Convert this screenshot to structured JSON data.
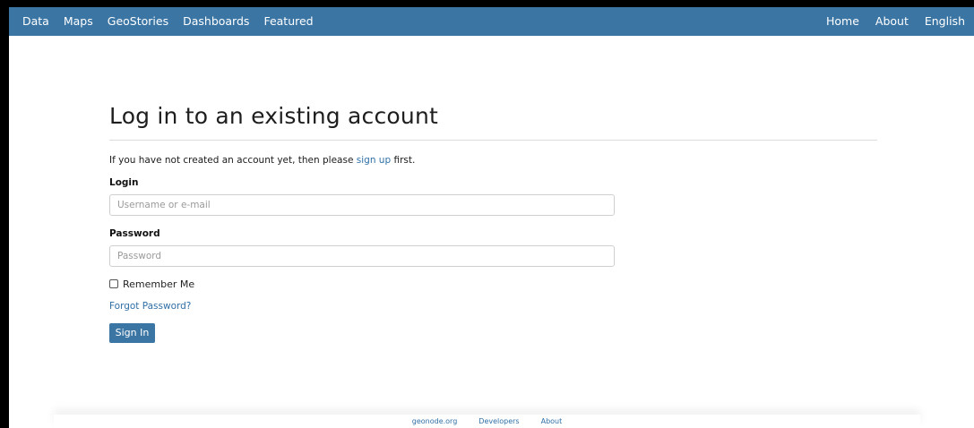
{
  "navbar": {
    "left_items": [
      "Data",
      "Maps",
      "GeoStories",
      "Dashboards",
      "Featured"
    ],
    "right_items": [
      "Home",
      "About",
      "English"
    ],
    "background_color": "#3b75a4"
  },
  "login_page": {
    "title": "Log in to an existing account",
    "intro_before": "If you have not created an account yet, then please ",
    "intro_link": "sign up",
    "intro_after": " first.",
    "login_label": "Login",
    "login_placeholder": "Username or e-mail",
    "login_value": "",
    "password_label": "Password",
    "password_placeholder": "Password",
    "password_value": "",
    "remember_label": "Remember Me",
    "remember_checked": false,
    "forgot_link": "Forgot Password?",
    "signin_button": "Sign In"
  },
  "footer": {
    "links": [
      "geonode.org",
      "Developers",
      "About"
    ]
  },
  "colors": {
    "accent": "#3b75a4",
    "link": "#2f6fa6"
  }
}
